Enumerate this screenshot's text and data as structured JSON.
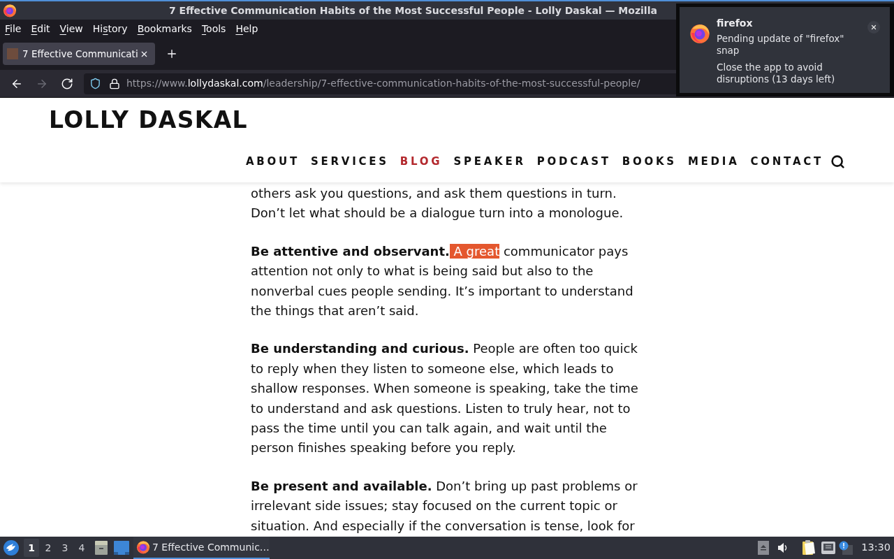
{
  "window": {
    "title": "7 Effective Communication Habits of the Most Successful People - Lolly Daskal — Mozilla"
  },
  "menu_bar": [
    {
      "label_parts": [
        {
          "text": "F",
          "underlined": true
        },
        {
          "text": "ile",
          "underlined": false
        }
      ]
    },
    {
      "label_parts": [
        {
          "text": "E",
          "underlined": true
        },
        {
          "text": "dit",
          "underlined": false
        }
      ]
    },
    {
      "label_parts": [
        {
          "text": "V",
          "underlined": true
        },
        {
          "text": "iew",
          "underlined": false
        }
      ]
    },
    {
      "label_parts": [
        {
          "text": "Hi",
          "underlined": false
        },
        {
          "text": "s",
          "underlined": true
        },
        {
          "text": "tory",
          "underlined": false
        }
      ]
    },
    {
      "label_parts": [
        {
          "text": "B",
          "underlined": true
        },
        {
          "text": "ookmarks",
          "underlined": false
        }
      ]
    },
    {
      "label_parts": [
        {
          "text": "T",
          "underlined": true
        },
        {
          "text": "ools",
          "underlined": false
        }
      ]
    },
    {
      "label_parts": [
        {
          "text": "H",
          "underlined": true
        },
        {
          "text": "elp",
          "underlined": false
        }
      ]
    }
  ],
  "tabs": [
    {
      "title": "7 Effective Communicati",
      "selected": true
    }
  ],
  "nav_buttons": [
    {
      "kind": "back",
      "disabled": false
    },
    {
      "kind": "forward",
      "disabled": true
    },
    {
      "kind": "reload",
      "disabled": false
    }
  ],
  "address_bar": {
    "prefix": "https://www.",
    "domain": "lollydaskal.com",
    "path": "/leadership/7-effective-communication-habits-of-the-most-successful-people/"
  },
  "notification": {
    "app_name": "firefox",
    "message": "Pending update of \"firefox\" snap",
    "detail": "Close the app to avoid disruptions (13 days left)"
  },
  "site": {
    "logo": "LOLLY DASKAL",
    "nav": [
      {
        "label": "ABOUT",
        "selected": false
      },
      {
        "label": "SERVICES",
        "selected": false
      },
      {
        "label": "BLOG",
        "selected": true
      },
      {
        "label": "SPEAKER",
        "selected": false
      },
      {
        "label": "PODCAST",
        "selected": false
      },
      {
        "label": "BOOKS",
        "selected": false
      },
      {
        "label": "MEDIA",
        "selected": false
      },
      {
        "label": "CONTACT",
        "selected": false
      }
    ]
  },
  "article": {
    "paragraphs": [
      {
        "segments": [
          {
            "text": "others ask you questions, and ask them questions in turn. Don’t let what should be a dialogue turn into a monologue.",
            "highlighted": false
          }
        ]
      },
      {
        "lead": "Be attentive and observant.",
        "segments": [
          {
            "text": " A great",
            "highlighted": true
          },
          {
            "text": " communicator pays attention not only to what is being said but also to the nonverbal cues people sending. It’s important to understand the things that aren’t said.",
            "highlighted": false
          }
        ]
      },
      {
        "lead": "Be understanding and curious.",
        "segments": [
          {
            "text": " People are often too quick to reply when they listen to someone else, which leads to shallow responses. When someone is speaking, take the time to understand and ask questions. Listen to truly hear, not to pass the time until you can talk again, and wait until the person finishes speaking before you reply.",
            "highlighted": false
          }
        ]
      },
      {
        "lead": "Be present and available.",
        "segments": [
          {
            "text": " Don’t bring up past problems or irrelevant side issues; stay focused on the current topic or situation. And especially if the conversation is tense, look for",
            "highlighted": false
          }
        ]
      }
    ]
  },
  "taskbar": {
    "workspaces": [
      {
        "label": "1",
        "selected": true
      },
      {
        "label": "2",
        "selected": false
      },
      {
        "label": "3",
        "selected": false
      },
      {
        "label": "4",
        "selected": false
      }
    ],
    "tasks": [
      {
        "title": "7 Effective Communic…",
        "selected": true
      }
    ],
    "clock": "13:30"
  }
}
